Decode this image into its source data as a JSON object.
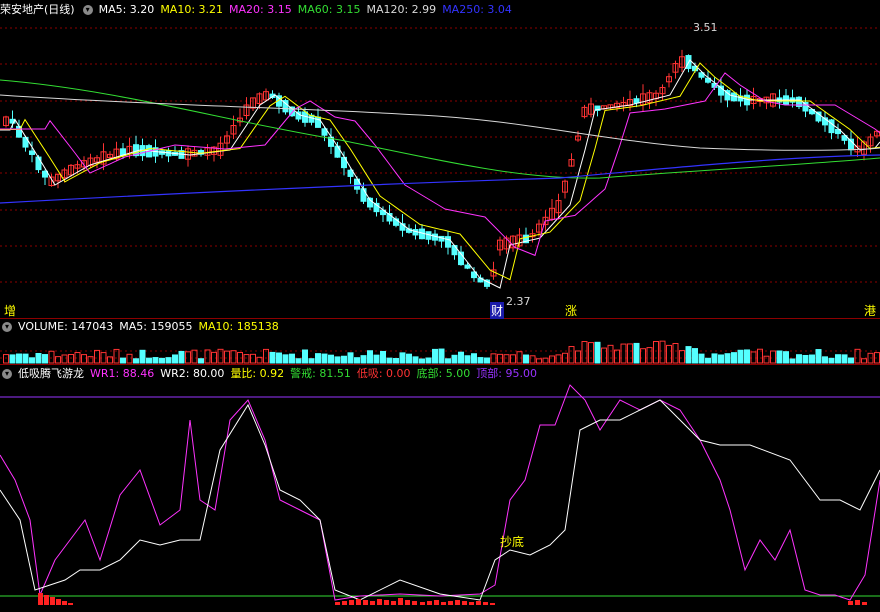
{
  "main_header": {
    "stock": "荣安地产(日线)",
    "items": [
      {
        "label": "MA5: 3.20",
        "color": "#ffffff"
      },
      {
        "label": "MA10: 3.21",
        "color": "#ffff00"
      },
      {
        "label": "MA20: 3.15",
        "color": "#ff33ff"
      },
      {
        "label": "MA60: 3.15",
        "color": "#33dd33"
      },
      {
        "label": "MA120: 2.99",
        "color": "#d8d8d8"
      },
      {
        "label": "MA250: 3.04",
        "color": "#3333ff"
      }
    ]
  },
  "volume_header": {
    "items": [
      {
        "label": "VOLUME: 147043",
        "color": "#ffffff"
      },
      {
        "label": "MA5: 159055",
        "color": "#ffffff"
      },
      {
        "label": "MA10: 185138",
        "color": "#ffff00"
      }
    ]
  },
  "indicator_header": {
    "name": "低吸腾飞游龙",
    "items": [
      {
        "label": "WR1: 88.46",
        "color": "#ff33ff"
      },
      {
        "label": "WR2: 80.00",
        "color": "#ffffff"
      },
      {
        "label": "量比: 0.92",
        "color": "#ffff00"
      },
      {
        "label": "警戒: 81.51",
        "color": "#33dd33"
      },
      {
        "label": "低吸: 0.00",
        "color": "#ff3333"
      },
      {
        "label": "底部: 5.00",
        "color": "#33dd33"
      },
      {
        "label": "顶部: 95.00",
        "color": "#9933ff"
      }
    ]
  },
  "annotations": {
    "high_price": "3.51",
    "low_price": "2.37",
    "chaodi": "抄底"
  },
  "markers": [
    {
      "label": "增",
      "color": "#ffff00"
    },
    {
      "label": "财",
      "color": "#ffffff",
      "bg": "#1a1aaa"
    },
    {
      "label": "涨",
      "color": "#ffff00"
    },
    {
      "label": "港",
      "color": "#ffff00"
    }
  ],
  "colors": {
    "up": "#ff3333",
    "down": "#54ffff",
    "grid": "#8c0000"
  }
}
